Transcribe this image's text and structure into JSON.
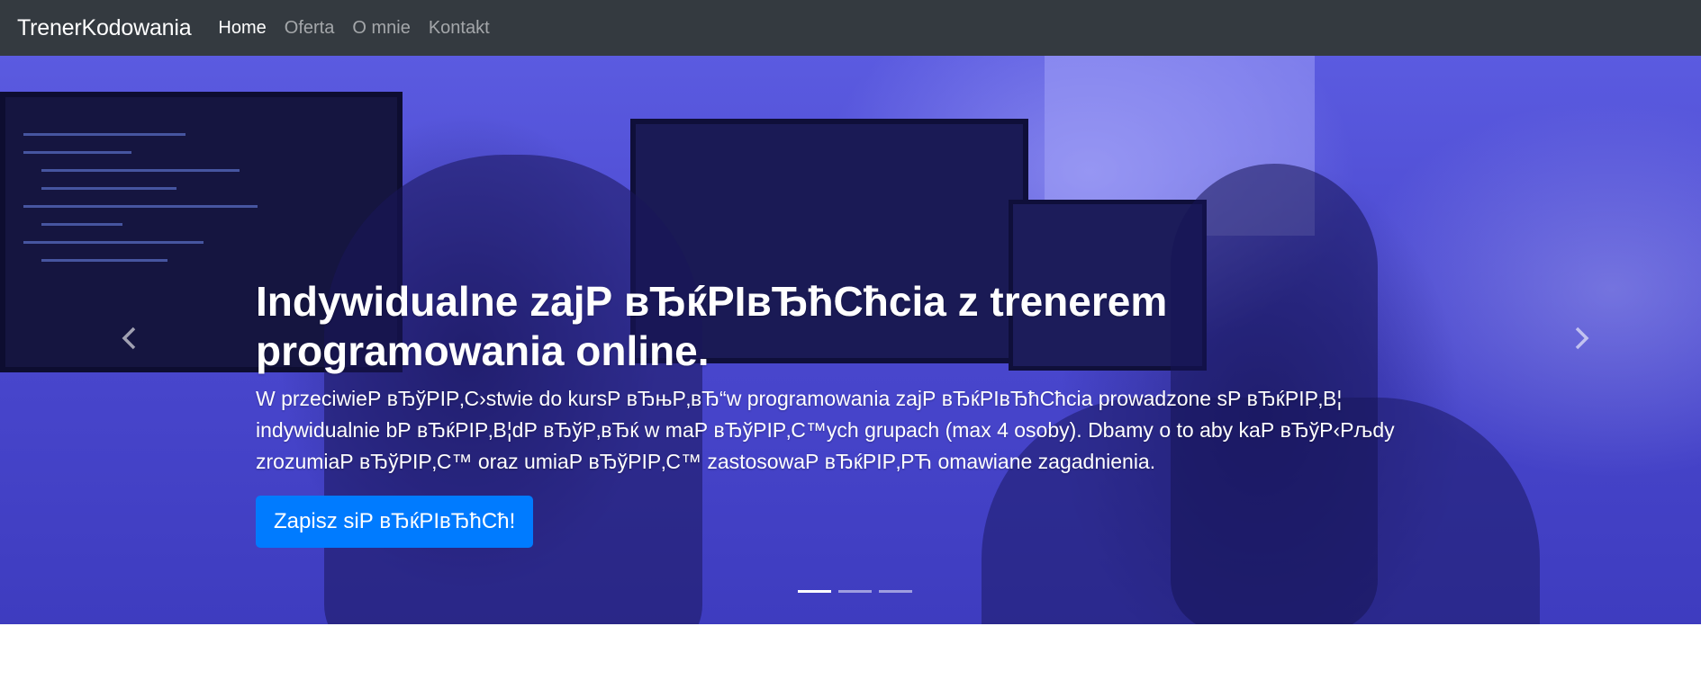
{
  "navbar": {
    "brand": "TrenerKodowania",
    "links": [
      {
        "label": "Home",
        "active": true
      },
      {
        "label": "Oferta",
        "active": false
      },
      {
        "label": "O mnie",
        "active": false
      },
      {
        "label": "Kontakt",
        "active": false
      }
    ],
    "background_color": "#343a40"
  },
  "hero": {
    "heading": "Indywidualne zajР вЂќРІвЂћСћcia z trenerem programowania online.",
    "description": "W przeciwieР вЂўРІР‚С›stwie do kursР вЂњР‚вЂ“w programowania zajР вЂќРІвЂћСћcia prowadzone sР вЂќРІР‚В¦ indywidualnie bР вЂќРІР‚В¦dР вЂўР‚вЂќ w maР вЂўРІР‚С™ych grupach (max 4 osoby). Dbamy o to aby kaР вЂўР‹Рљdy zrozumiaР вЂўРІР‚С™ oraz umiaР вЂўРІР‚С™ zastosowaР вЂќРІР‚РЋ omawiane zagadnienia.",
    "cta_label": "Zapisz siР вЂќРІвЂћСћ!",
    "cta_color": "#007bff",
    "overlay_color": "#4b4bd6",
    "indicators": {
      "count": 3,
      "active_index": 0
    },
    "controls": {
      "prev_icon": "chevron-left-icon",
      "next_icon": "chevron-right-icon"
    }
  }
}
